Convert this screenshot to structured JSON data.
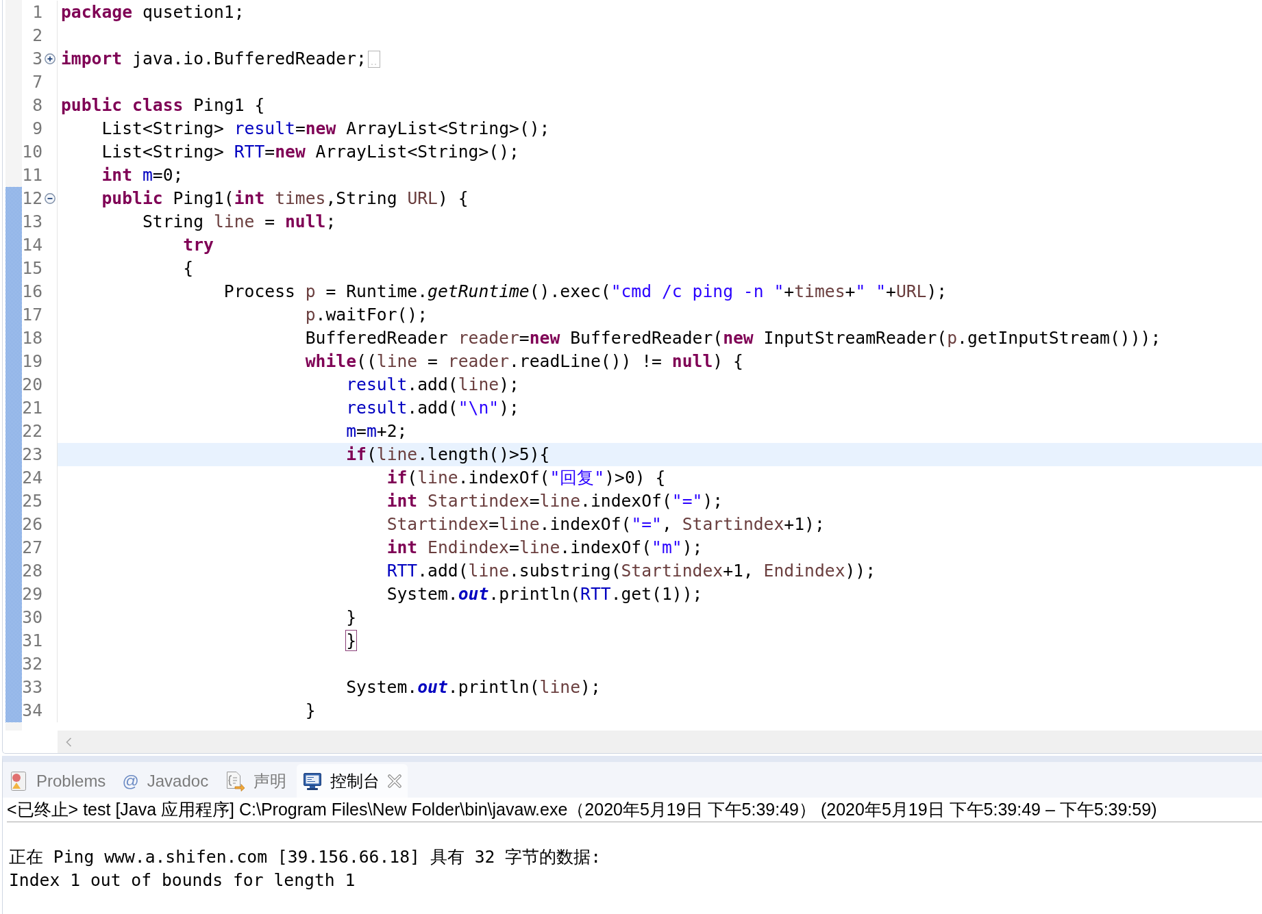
{
  "editor": {
    "lines": [
      {
        "number": "1",
        "changed": false,
        "current": false,
        "tokens": [
          {
            "text": "package",
            "kind": "keyword"
          },
          {
            "text": " qusetion1;",
            "kind": "plain"
          }
        ]
      },
      {
        "number": "2",
        "changed": false,
        "current": false
      },
      {
        "number": "3",
        "changed": false,
        "current": false,
        "fold": {
          "expanded": false
        },
        "tokens": [
          {
            "text": "import",
            "kind": "keyword"
          },
          {
            "text": " java.io.BufferedReader;",
            "kind": "plain"
          }
        ]
      },
      {
        "number": "7",
        "changed": false,
        "current": false
      },
      {
        "number": "8",
        "changed": false,
        "current": false,
        "tokens": [
          {
            "text": "public",
            "kind": "keyword"
          },
          {
            "text": " class",
            "kind": "keyword"
          },
          {
            "text": " Ping1 {",
            "kind": "plain"
          }
        ]
      },
      {
        "number": "9",
        "changed": false,
        "current": false,
        "tokens": [
          {
            "text": "    List<String> ",
            "kind": "plain"
          },
          {
            "text": "result",
            "kind": "field"
          },
          {
            "text": "=",
            "kind": "plain"
          },
          {
            "text": "new",
            "kind": "keyword"
          },
          {
            "text": " ArrayList<String>();",
            "kind": "plain"
          }
        ]
      },
      {
        "number": "10",
        "changed": false,
        "current": false,
        "tokens": [
          {
            "text": "    List<String> ",
            "kind": "plain"
          },
          {
            "text": "RTT",
            "kind": "field"
          },
          {
            "text": "=",
            "kind": "plain"
          },
          {
            "text": "new",
            "kind": "keyword"
          },
          {
            "text": " ArrayList<String>();",
            "kind": "plain"
          }
        ]
      },
      {
        "number": "11",
        "changed": false,
        "current": false,
        "tokens": [
          {
            "text": "    int",
            "kind": "keyword"
          },
          {
            "text": " m",
            "kind": "field"
          },
          {
            "text": "=0;",
            "kind": "plain"
          }
        ]
      },
      {
        "number": "12",
        "changed": true,
        "current": false,
        "fold": {
          "expanded": true
        },
        "tokens": [
          {
            "text": "    public",
            "kind": "keyword"
          },
          {
            "text": " Ping1(",
            "kind": "plain"
          },
          {
            "text": "int",
            "kind": "keyword"
          },
          {
            "text": " times",
            "kind": "variable"
          },
          {
            "text": ",String ",
            "kind": "plain"
          },
          {
            "text": "URL",
            "kind": "variable"
          },
          {
            "text": ") {",
            "kind": "plain"
          }
        ]
      },
      {
        "number": "13",
        "changed": true,
        "current": false,
        "tokens": [
          {
            "text": "        String ",
            "kind": "plain"
          },
          {
            "text": "line",
            "kind": "variable"
          },
          {
            "text": " = ",
            "kind": "plain"
          },
          {
            "text": "null",
            "kind": "keyword"
          },
          {
            "text": ";",
            "kind": "plain"
          }
        ]
      },
      {
        "number": "14",
        "changed": true,
        "current": false,
        "tokens": [
          {
            "text": "            try",
            "kind": "keyword"
          }
        ]
      },
      {
        "number": "15",
        "changed": true,
        "current": false,
        "tokens": [
          {
            "text": "            {",
            "kind": "plain"
          }
        ]
      },
      {
        "number": "16",
        "changed": true,
        "current": false,
        "tokens": [
          {
            "text": "                Process ",
            "kind": "plain"
          },
          {
            "text": "p",
            "kind": "variable"
          },
          {
            "text": " = Runtime.",
            "kind": "plain"
          },
          {
            "text": "getRuntime",
            "kind": "static_method"
          },
          {
            "text": "().exec(",
            "kind": "plain"
          },
          {
            "text": "\"cmd /c ping -n \"",
            "kind": "string"
          },
          {
            "text": "+",
            "kind": "plain"
          },
          {
            "text": "times",
            "kind": "variable"
          },
          {
            "text": "+",
            "kind": "plain"
          },
          {
            "text": "\" \"",
            "kind": "string"
          },
          {
            "text": "+",
            "kind": "plain"
          },
          {
            "text": "URL",
            "kind": "variable"
          },
          {
            "text": ");",
            "kind": "plain"
          }
        ]
      },
      {
        "number": "17",
        "changed": true,
        "current": false,
        "tokens": [
          {
            "text": "                        p",
            "kind": "variable"
          },
          {
            "text": ".waitFor();",
            "kind": "plain"
          }
        ]
      },
      {
        "number": "18",
        "changed": true,
        "current": false,
        "tokens": [
          {
            "text": "                        BufferedReader ",
            "kind": "plain"
          },
          {
            "text": "reader",
            "kind": "variable"
          },
          {
            "text": "=",
            "kind": "plain"
          },
          {
            "text": "new",
            "kind": "keyword"
          },
          {
            "text": " BufferedReader(",
            "kind": "plain"
          },
          {
            "text": "new",
            "kind": "keyword"
          },
          {
            "text": " InputStreamReader(",
            "kind": "plain"
          },
          {
            "text": "p",
            "kind": "variable"
          },
          {
            "text": ".getInputStream()));",
            "kind": "plain"
          }
        ]
      },
      {
        "number": "19",
        "changed": true,
        "current": false,
        "tokens": [
          {
            "text": "                        while",
            "kind": "keyword"
          },
          {
            "text": "((",
            "kind": "plain"
          },
          {
            "text": "line",
            "kind": "variable"
          },
          {
            "text": " = ",
            "kind": "plain"
          },
          {
            "text": "reader",
            "kind": "variable"
          },
          {
            "text": ".readLine()) != ",
            "kind": "plain"
          },
          {
            "text": "null",
            "kind": "keyword"
          },
          {
            "text": ") {",
            "kind": "plain"
          }
        ]
      },
      {
        "number": "20",
        "changed": true,
        "current": false,
        "tokens": [
          {
            "text": "                            result",
            "kind": "field"
          },
          {
            "text": ".add(",
            "kind": "plain"
          },
          {
            "text": "line",
            "kind": "variable"
          },
          {
            "text": ");",
            "kind": "plain"
          }
        ]
      },
      {
        "number": "21",
        "changed": true,
        "current": false,
        "tokens": [
          {
            "text": "                            result",
            "kind": "field"
          },
          {
            "text": ".add(",
            "kind": "plain"
          },
          {
            "text": "\"\\n\"",
            "kind": "string"
          },
          {
            "text": ");",
            "kind": "plain"
          }
        ]
      },
      {
        "number": "22",
        "changed": true,
        "current": false,
        "tokens": [
          {
            "text": "                            m",
            "kind": "field"
          },
          {
            "text": "=",
            "kind": "plain"
          },
          {
            "text": "m",
            "kind": "field"
          },
          {
            "text": "+2;",
            "kind": "plain"
          }
        ]
      },
      {
        "number": "23",
        "changed": true,
        "current": true,
        "tokens": [
          {
            "text": "                            if",
            "kind": "keyword"
          },
          {
            "text": "(",
            "kind": "plain"
          },
          {
            "text": "line",
            "kind": "variable"
          },
          {
            "text": ".length()>5){",
            "kind": "plain"
          }
        ]
      },
      {
        "number": "24",
        "changed": true,
        "current": false,
        "tokens": [
          {
            "text": "                                if",
            "kind": "keyword"
          },
          {
            "text": "(",
            "kind": "plain"
          },
          {
            "text": "line",
            "kind": "variable"
          },
          {
            "text": ".indexOf(",
            "kind": "plain"
          },
          {
            "text": "\"回复\"",
            "kind": "string"
          },
          {
            "text": ")>0) {",
            "kind": "plain"
          }
        ]
      },
      {
        "number": "25",
        "changed": true,
        "current": false,
        "tokens": [
          {
            "text": "                                int",
            "kind": "keyword"
          },
          {
            "text": " Startindex",
            "kind": "variable"
          },
          {
            "text": "=",
            "kind": "plain"
          },
          {
            "text": "line",
            "kind": "variable"
          },
          {
            "text": ".indexOf(",
            "kind": "plain"
          },
          {
            "text": "\"=\"",
            "kind": "string"
          },
          {
            "text": ");",
            "kind": "plain"
          }
        ]
      },
      {
        "number": "26",
        "changed": true,
        "current": false,
        "tokens": [
          {
            "text": "                                Startindex",
            "kind": "variable"
          },
          {
            "text": "=",
            "kind": "plain"
          },
          {
            "text": "line",
            "kind": "variable"
          },
          {
            "text": ".indexOf(",
            "kind": "plain"
          },
          {
            "text": "\"=\"",
            "kind": "string"
          },
          {
            "text": ", ",
            "kind": "plain"
          },
          {
            "text": "Startindex",
            "kind": "variable"
          },
          {
            "text": "+1);",
            "kind": "plain"
          }
        ]
      },
      {
        "number": "27",
        "changed": true,
        "current": false,
        "tokens": [
          {
            "text": "                                int",
            "kind": "keyword"
          },
          {
            "text": " Endindex",
            "kind": "variable"
          },
          {
            "text": "=",
            "kind": "plain"
          },
          {
            "text": "line",
            "kind": "variable"
          },
          {
            "text": ".indexOf(",
            "kind": "plain"
          },
          {
            "text": "\"m\"",
            "kind": "string"
          },
          {
            "text": ");",
            "kind": "plain"
          }
        ]
      },
      {
        "number": "28",
        "changed": true,
        "current": false,
        "tokens": [
          {
            "text": "                                RTT",
            "kind": "field"
          },
          {
            "text": ".add(",
            "kind": "plain"
          },
          {
            "text": "line",
            "kind": "variable"
          },
          {
            "text": ".substring(",
            "kind": "plain"
          },
          {
            "text": "Startindex",
            "kind": "variable"
          },
          {
            "text": "+1, ",
            "kind": "plain"
          },
          {
            "text": "Endindex",
            "kind": "variable"
          },
          {
            "text": "));",
            "kind": "plain"
          }
        ]
      },
      {
        "number": "29",
        "changed": true,
        "current": false,
        "tokens": [
          {
            "text": "                                System.",
            "kind": "plain"
          },
          {
            "text": "out",
            "kind": "static_field"
          },
          {
            "text": ".println(",
            "kind": "plain"
          },
          {
            "text": "RTT",
            "kind": "field"
          },
          {
            "text": ".get(1));",
            "kind": "plain"
          }
        ]
      },
      {
        "number": "30",
        "changed": true,
        "current": false,
        "tokens": [
          {
            "text": "                            }",
            "kind": "plain"
          }
        ]
      },
      {
        "number": "31",
        "changed": true,
        "current": false,
        "tokens": [
          {
            "text": "                            }",
            "kind": "bracket_match"
          }
        ]
      },
      {
        "number": "32",
        "changed": true,
        "current": false
      },
      {
        "number": "33",
        "changed": true,
        "current": false,
        "tokens": [
          {
            "text": "                            System.",
            "kind": "plain"
          },
          {
            "text": "out",
            "kind": "static_field"
          },
          {
            "text": ".println(",
            "kind": "plain"
          },
          {
            "text": "line",
            "kind": "variable"
          },
          {
            "text": ");",
            "kind": "plain"
          }
        ]
      },
      {
        "number": "34",
        "changed": true,
        "current": false,
        "tokens": [
          {
            "text": "                        }",
            "kind": "plain"
          }
        ]
      }
    ]
  },
  "views": {
    "tabs": [
      {
        "label": "Problems",
        "kind": "problems",
        "selected": false
      },
      {
        "label": "Javadoc",
        "kind": "javadoc",
        "glyph": "@",
        "selected": false
      },
      {
        "label": "声明",
        "kind": "declaration",
        "selected": false
      },
      {
        "label": "控制台",
        "kind": "console",
        "selected": true
      }
    ]
  },
  "console": {
    "header": "<已终止> test [Java 应用程序] C:\\Program Files\\New Folder\\bin\\javaw.exe（2020年5月19日 下午5:39:49） (2020年5月19日 下午5:39:49 – 下午5:39:59)",
    "output": [
      "正在 Ping www.a.shifen.com [39.156.66.18] 具有 32 字节的数据:",
      "Index 1 out of bounds for length 1"
    ]
  }
}
